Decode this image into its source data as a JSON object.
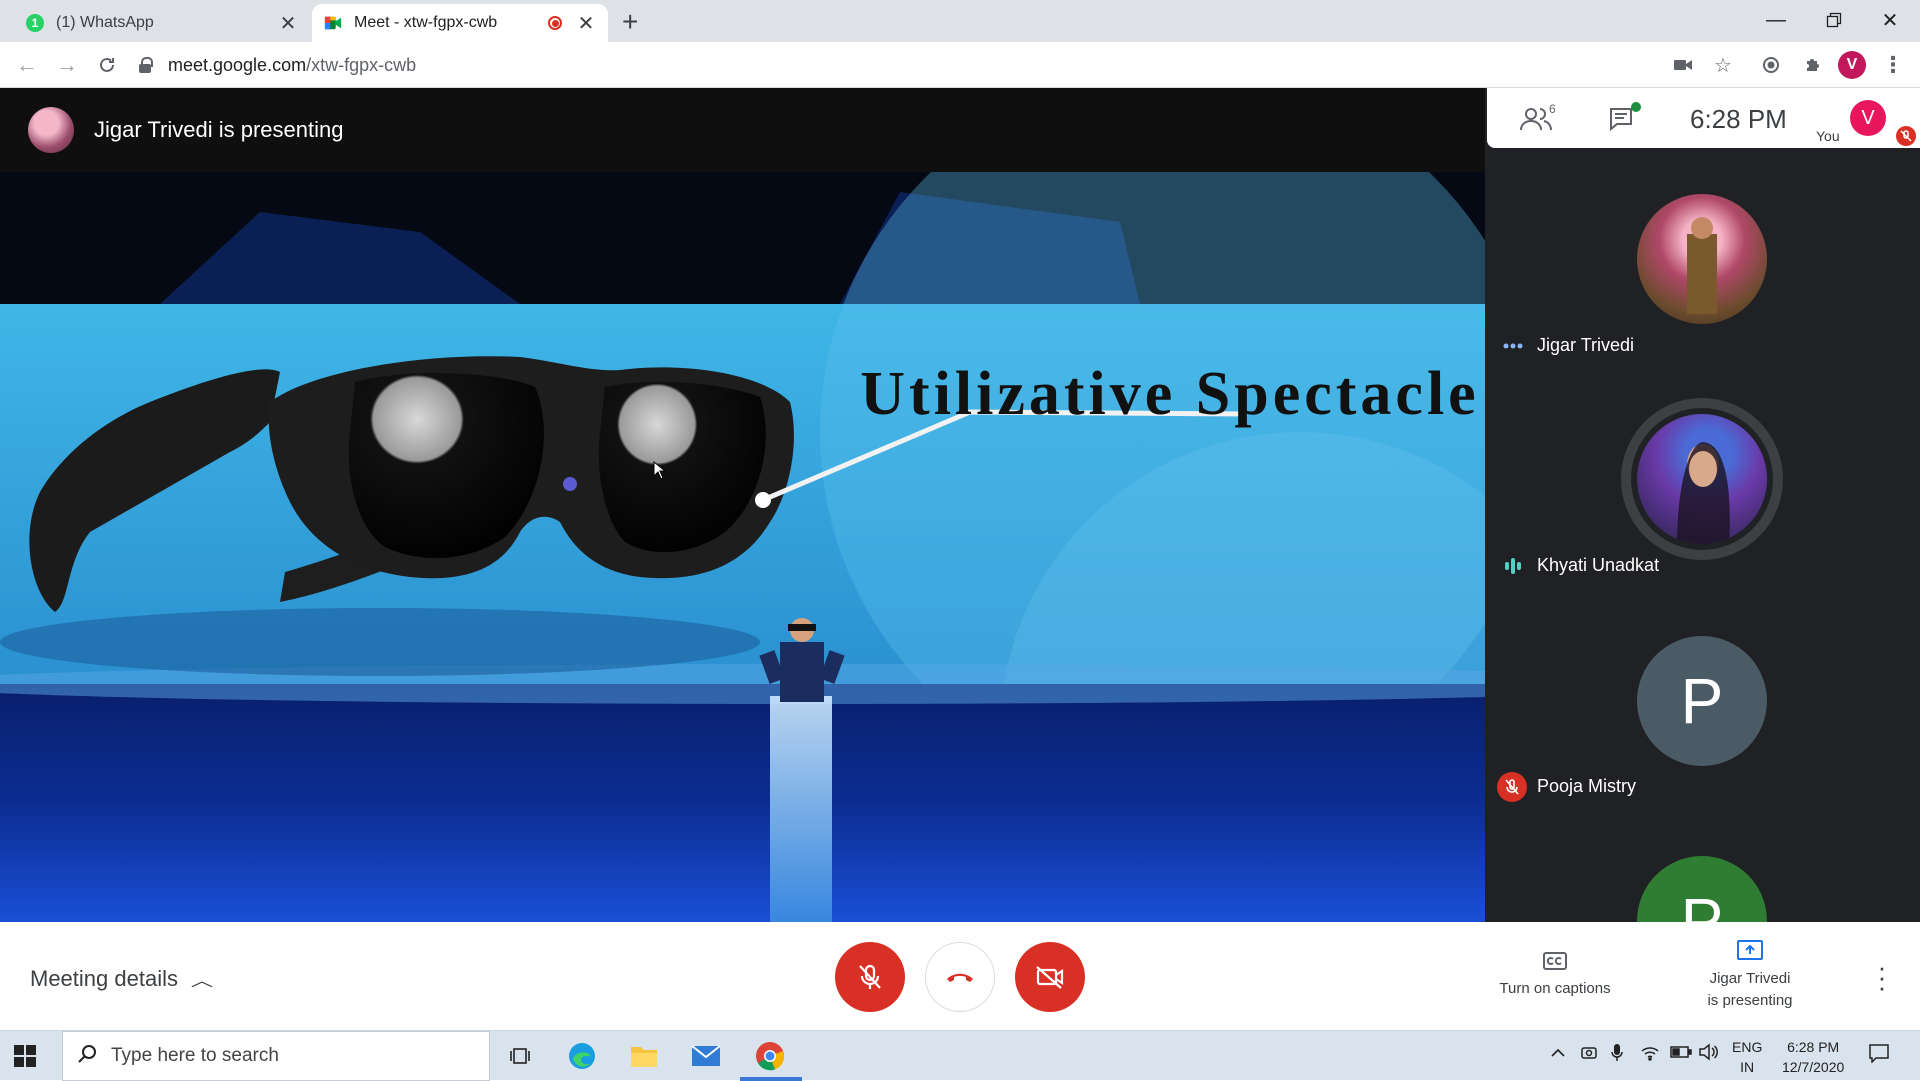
{
  "browser": {
    "tabs": [
      {
        "title": "(1) WhatsApp",
        "badge": "1",
        "active": false
      },
      {
        "title": "Meet - xtw-fgpx-cwb",
        "active": true
      }
    ],
    "url_host": "meet.google.com",
    "url_path": "/xtw-fgpx-cwb"
  },
  "meet": {
    "presenter_banner": "Jigar Trivedi is presenting",
    "slide_title": "Utilizative Spectacle",
    "clock": "6:28 PM",
    "people_count": "6",
    "you_initial": "V",
    "you_label": "You",
    "participants": [
      {
        "name": "Jigar Trivedi",
        "status": "more"
      },
      {
        "name": "Khyati Unadkat",
        "status": "speaking"
      },
      {
        "name": "Pooja Mistry",
        "status": "muted",
        "initial": "P"
      },
      {
        "name": "",
        "initial": "P"
      }
    ],
    "controls": {
      "meeting_details": "Meeting details",
      "captions": "Turn on captions",
      "presenting_line1": "Jigar Trivedi",
      "presenting_line2": "is presenting"
    }
  },
  "taskbar": {
    "search_placeholder": "Type here to search",
    "lang_line1": "ENG",
    "lang_line2": "IN",
    "time": "6:28 PM",
    "date": "12/7/2020"
  },
  "colors": {
    "danger": "#d93025",
    "meet_bg": "#202124",
    "slide_blue": "#3fb0de"
  }
}
